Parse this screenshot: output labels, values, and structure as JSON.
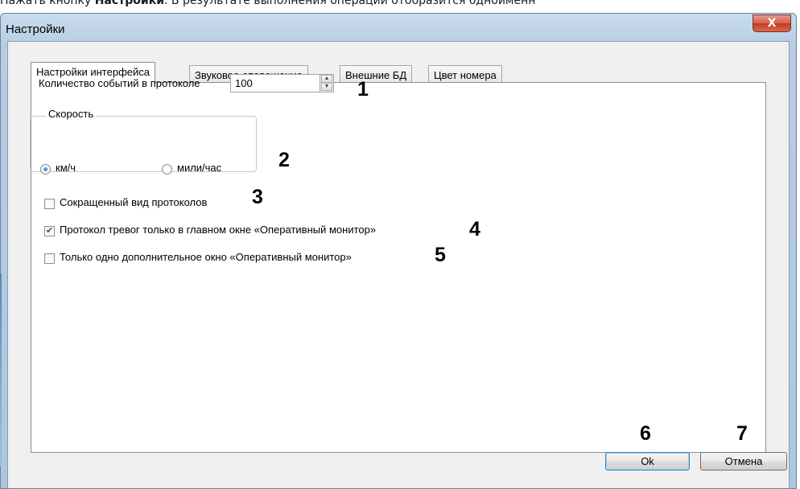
{
  "doc": {
    "prefix": "Нажать кнопку ",
    "bold": "Настройки",
    "suffix": ". В результате выполнения операции отобразится одноименн"
  },
  "window": {
    "title": "Настройки",
    "close_glyph": "X"
  },
  "tabs": [
    {
      "label": "Настройки интерфейса",
      "active": true
    },
    {
      "label": "Звуковое оповещение",
      "active": false
    },
    {
      "label": "Внешние БД",
      "active": false
    },
    {
      "label": "Цвет номера",
      "active": false
    }
  ],
  "events": {
    "label": "Количество событий в протоколе",
    "value": "100"
  },
  "speed": {
    "legend": "Скорость",
    "options": [
      {
        "label": "км/ч",
        "selected": true
      },
      {
        "label": "мили/час",
        "selected": false
      }
    ]
  },
  "checkboxes": [
    {
      "label": "Сокращенный вид протоколов",
      "checked": false
    },
    {
      "label": "Протокол тревог только в главном окне «Оперативный монитор»",
      "checked": true
    },
    {
      "label": "Только одно дополнительное окно «Оперативный монитор»",
      "checked": false
    }
  ],
  "buttons": {
    "ok": "Ok",
    "cancel": "Отмена"
  },
  "callouts": [
    "1",
    "2",
    "3",
    "4",
    "5",
    "6",
    "7"
  ],
  "icons": {
    "spin_up": "up-arrow-icon",
    "spin_down": "down-arrow-icon",
    "check_mark": "✔"
  },
  "colors": {
    "titlebar": "#b7cde4",
    "close_button": "#c1391f",
    "radio_dot": "#1a5fc1"
  }
}
